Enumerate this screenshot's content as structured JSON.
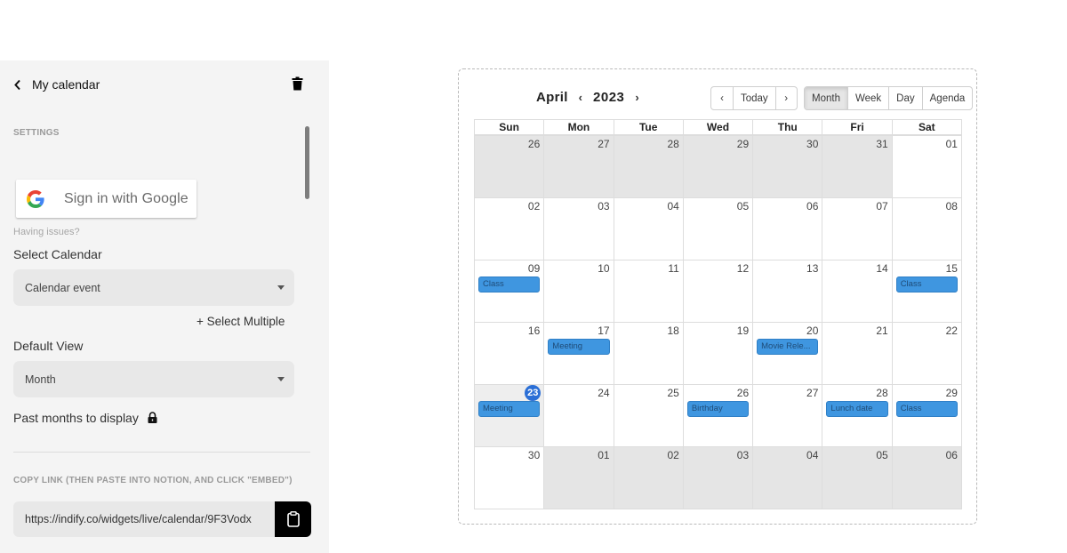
{
  "panel": {
    "title": "My calendar",
    "settings_label": "SETTINGS",
    "google_button": "Sign in with Google",
    "having_issues": "Having issues?",
    "select_calendar_label": "Select Calendar",
    "select_calendar_value": "Calendar event",
    "select_multiple": "+ Select Multiple",
    "default_view_label": "Default View",
    "default_view_value": "Month",
    "past_months_label": "Past months to display",
    "copy_link_label": "COPY LINK (THEN PASTE INTO NOTION, AND CLICK \"EMBED\")",
    "copy_link_url": "https://indify.co/widgets/live/calendar/9F3Vodx"
  },
  "calendar": {
    "month": "April",
    "year": "2023",
    "prev_year": "‹",
    "next_year": "›",
    "nav_buttons": {
      "prev": "‹",
      "today": "Today",
      "next": "›"
    },
    "views": [
      {
        "label": "Month",
        "active": true
      },
      {
        "label": "Week",
        "active": false
      },
      {
        "label": "Day",
        "active": false
      },
      {
        "label": "Agenda",
        "active": false
      }
    ],
    "weekdays": [
      "Sun",
      "Mon",
      "Tue",
      "Wed",
      "Thu",
      "Fri",
      "Sat"
    ],
    "event_color": "#3f96e0",
    "today_color": "#2b6fd6",
    "weeks": [
      [
        {
          "day": "26",
          "off": true
        },
        {
          "day": "27",
          "off": true
        },
        {
          "day": "28",
          "off": true
        },
        {
          "day": "29",
          "off": true
        },
        {
          "day": "30",
          "off": true
        },
        {
          "day": "31",
          "off": true
        },
        {
          "day": "01"
        }
      ],
      [
        {
          "day": "02"
        },
        {
          "day": "03"
        },
        {
          "day": "04"
        },
        {
          "day": "05"
        },
        {
          "day": "06"
        },
        {
          "day": "07"
        },
        {
          "day": "08"
        }
      ],
      [
        {
          "day": "09",
          "event": "Class"
        },
        {
          "day": "10"
        },
        {
          "day": "11"
        },
        {
          "day": "12"
        },
        {
          "day": "13"
        },
        {
          "day": "14"
        },
        {
          "day": "15",
          "event": "Class"
        }
      ],
      [
        {
          "day": "16"
        },
        {
          "day": "17",
          "event": "Meeting"
        },
        {
          "day": "18"
        },
        {
          "day": "19"
        },
        {
          "day": "20",
          "event": "Movie Rele..."
        },
        {
          "day": "21"
        },
        {
          "day": "22"
        }
      ],
      [
        {
          "day": "23",
          "today": true,
          "event": "Meeting"
        },
        {
          "day": "24"
        },
        {
          "day": "25"
        },
        {
          "day": "26",
          "event": "Birthday"
        },
        {
          "day": "27"
        },
        {
          "day": "28",
          "event": "Lunch date"
        },
        {
          "day": "29",
          "event": "Class"
        }
      ],
      [
        {
          "day": "30"
        },
        {
          "day": "01",
          "off": true
        },
        {
          "day": "02",
          "off": true
        },
        {
          "day": "03",
          "off": true
        },
        {
          "day": "04",
          "off": true
        },
        {
          "day": "05",
          "off": true
        },
        {
          "day": "06",
          "off": true
        }
      ]
    ]
  }
}
